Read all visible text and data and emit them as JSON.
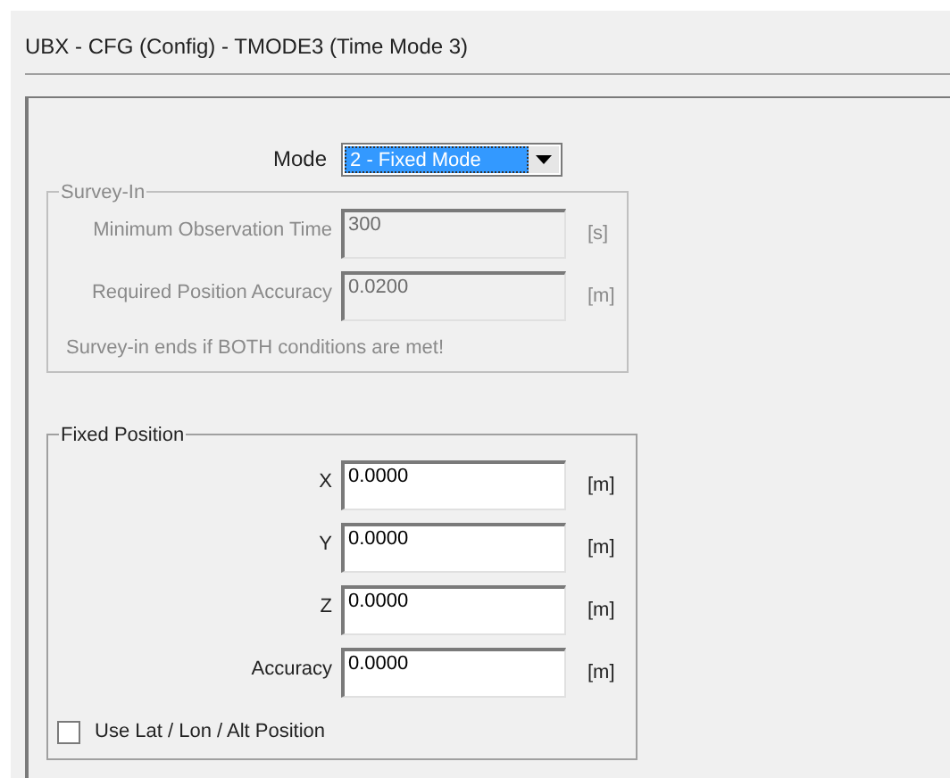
{
  "window": {
    "title": "UBX - CFG (Config) - TMODE3 (Time Mode 3)"
  },
  "mode": {
    "label": "Mode",
    "value": "2 - Fixed Mode",
    "selected": true
  },
  "survey_in": {
    "title": "Survey-In",
    "disabled": true,
    "fields": [
      {
        "label": "Minimum Observation Time",
        "value": "300",
        "unit": "[s]"
      },
      {
        "label": "Required Position Accuracy",
        "value": "0.0200",
        "unit": "[m]"
      }
    ],
    "note": "Survey-in ends if BOTH conditions are met!"
  },
  "fixed_position": {
    "title": "Fixed Position",
    "fields": [
      {
        "label": "X",
        "value": "0.0000",
        "unit": "[m]"
      },
      {
        "label": "Y",
        "value": "0.0000",
        "unit": "[m]"
      },
      {
        "label": "Z",
        "value": "0.0000",
        "unit": "[m]"
      },
      {
        "label": "Accuracy",
        "value": "0.0000",
        "unit": "[m]"
      }
    ],
    "checkbox": {
      "label": "Use Lat / Lon / Alt Position",
      "checked": false
    }
  }
}
